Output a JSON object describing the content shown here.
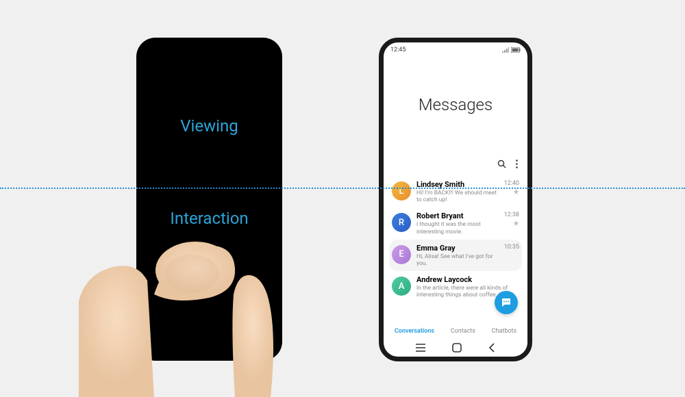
{
  "left": {
    "viewing": "Viewing",
    "interaction": "Interaction"
  },
  "right": {
    "time": "12:45",
    "title": "Messages",
    "conversations": [
      {
        "initial": "L",
        "name": "Lindsey Smith",
        "preview": "Hi! I'm BACK!!!\nWe should meet to catch up!",
        "time": "12:40",
        "pinned": true,
        "color": "linear-gradient(135deg,#f5b740,#e88f2c)"
      },
      {
        "initial": "R",
        "name": "Robert Bryant",
        "preview": "I thought it was the most interesting movie.",
        "time": "12:38",
        "pinned": true,
        "color": "linear-gradient(135deg,#3a7de0,#2c5fc4)"
      },
      {
        "initial": "E",
        "name": "Emma Gray",
        "preview": "Hi, Alisa!\nSee what I've got for you.",
        "time": "10:35",
        "pinned": false,
        "color": "linear-gradient(135deg,#c99de8,#a977d6)"
      },
      {
        "initial": "A",
        "name": "Andrew Laycock",
        "preview": "In the article, there were all kinds of interesting things about coffee",
        "time": "",
        "pinned": false,
        "color": "linear-gradient(135deg,#4fcaa0,#2fae80)"
      }
    ],
    "tabs": {
      "conversations": "Conversations",
      "contacts": "Contacts",
      "chatbots": "Chatbots"
    }
  }
}
